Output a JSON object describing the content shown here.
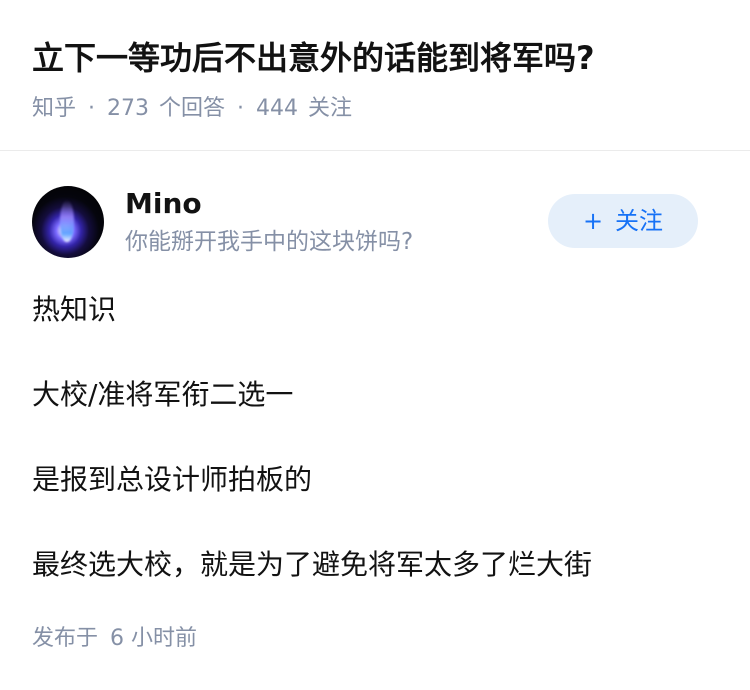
{
  "question": {
    "title": "立下一等功后不出意外的话能到将军吗?",
    "source": "知乎",
    "answer_count": "273",
    "answer_label": "个回答",
    "follow_count": "444",
    "follow_label": "关注"
  },
  "author": {
    "name": "Mino",
    "headline": "你能掰开我手中的这块饼吗?",
    "follow_button": "关注",
    "follow_icon": "plus-icon"
  },
  "answer": {
    "paragraphs": [
      "热知识",
      "大校/准将军衔二选一",
      "是报到总设计师拍板的",
      "最终选大校，就是为了避免将军太多了烂大街"
    ]
  },
  "footer": {
    "published_label": "发布于",
    "published_time": "6 小时前"
  },
  "colors": {
    "text": "#121212",
    "meta": "#8590a6",
    "accent": "#1772f6",
    "follow_bg": "#e5effa"
  }
}
